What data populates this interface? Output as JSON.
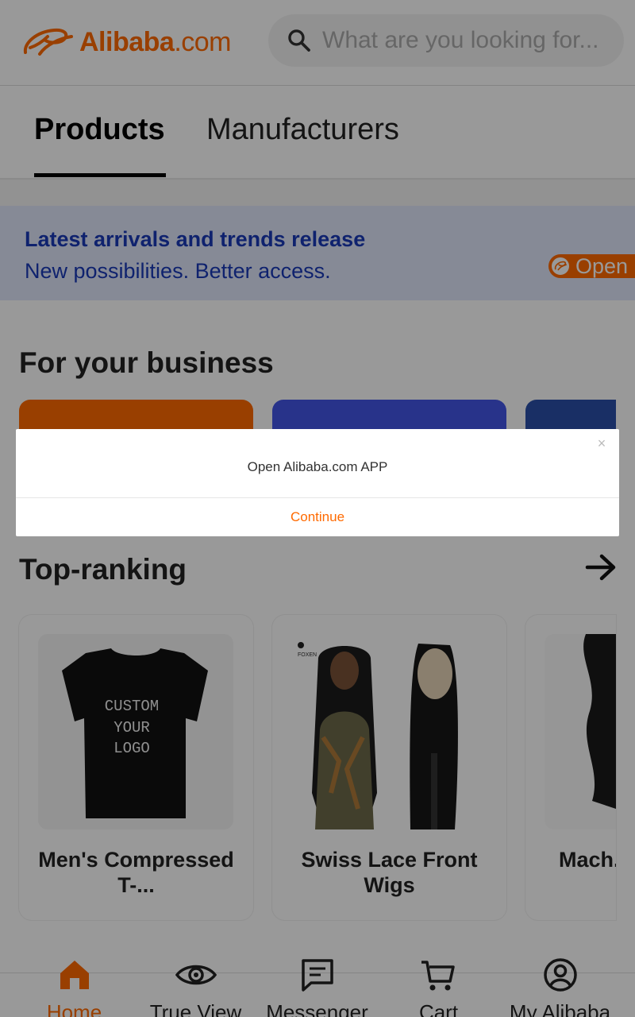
{
  "header": {
    "logo_text": "Alibaba",
    "logo_suffix": ".com",
    "search_placeholder": "What are you looking for..."
  },
  "tabs": [
    {
      "label": "Products",
      "active": true
    },
    {
      "label": "Manufacturers",
      "active": false
    }
  ],
  "banner": {
    "title": "Latest arrivals and trends release",
    "subtitle": "New possibilities. Better access.",
    "open_label": "Open"
  },
  "business": {
    "title": "For your business"
  },
  "top_ranking": {
    "title": "Top-ranking",
    "products": [
      {
        "name": "Men's Compressed T-..."
      },
      {
        "name": "Swiss Lace Front Wigs"
      },
      {
        "name": "Mach... W..."
      }
    ],
    "tshirt_print": [
      "CUSTOM",
      "YOUR",
      "LOGO"
    ],
    "brand_mark": "FOXEN"
  },
  "bottom_nav": [
    {
      "label": "Home",
      "icon": "home-icon",
      "active": true
    },
    {
      "label": "True View",
      "icon": "eye-icon",
      "active": false
    },
    {
      "label": "Messenger",
      "icon": "message-icon",
      "active": false
    },
    {
      "label": "Cart",
      "icon": "cart-icon",
      "active": false
    },
    {
      "label": "My Alibaba",
      "icon": "user-icon",
      "active": false
    }
  ],
  "modal": {
    "message": "Open Alibaba.com APP",
    "close": "×",
    "continue_label": "Continue"
  },
  "colors": {
    "brand": "#ff6a00",
    "banner_bg": "#dfe6fb",
    "banner_text": "#1a3ab8"
  }
}
